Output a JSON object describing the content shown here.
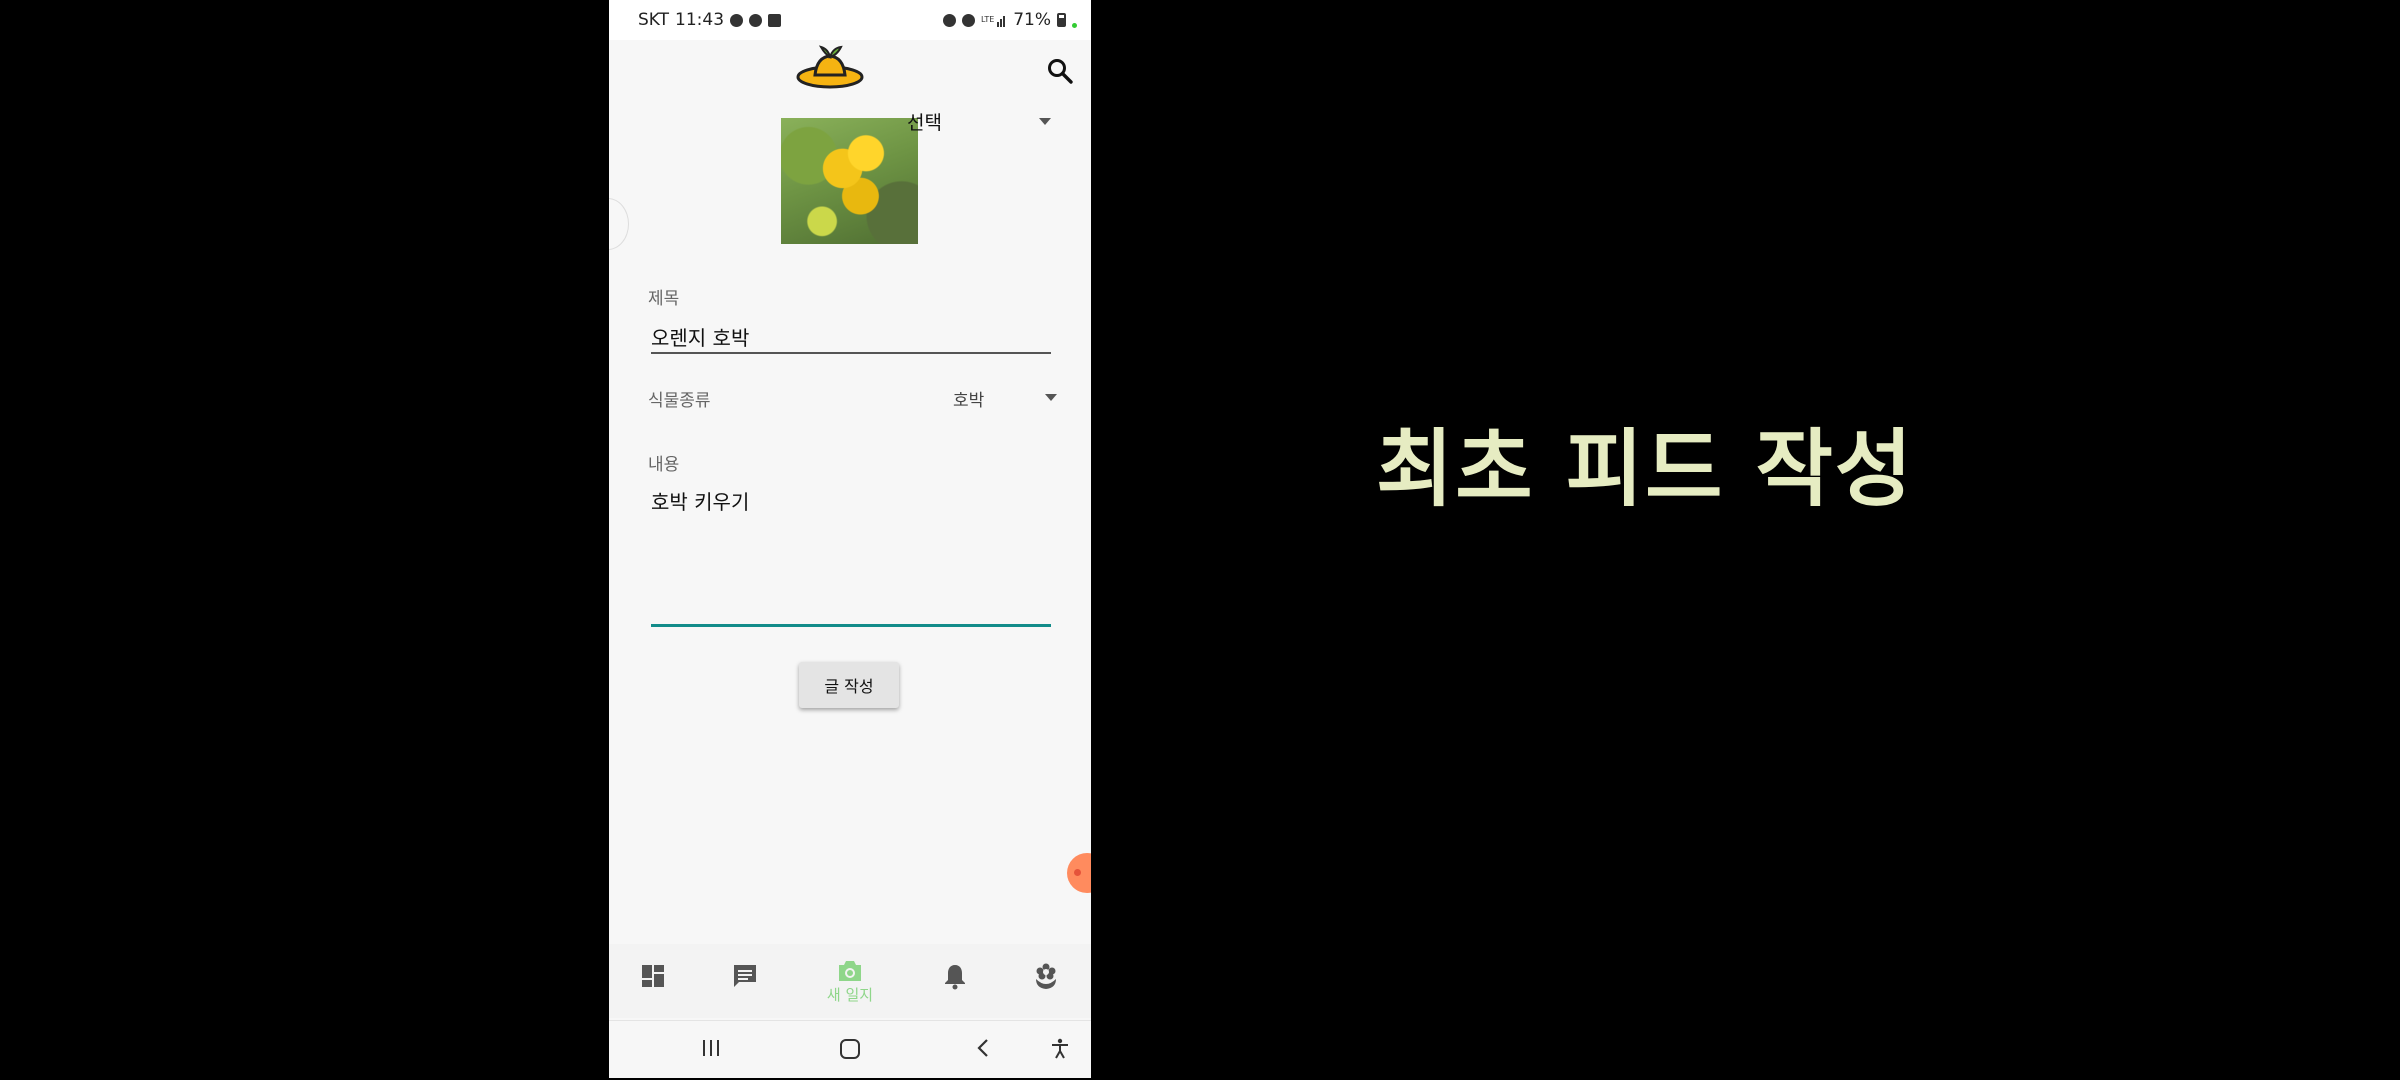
{
  "status_bar": {
    "carrier": "SKT",
    "time": "11:43",
    "battery": "71%"
  },
  "header": {
    "logo_icon": "orange-logo-icon",
    "search_icon": "search-icon"
  },
  "form": {
    "photo_select": {
      "selected": "선택"
    },
    "title_label": "제목",
    "title_value": "오렌지 호박",
    "plant_type_label": "식물종류",
    "plant_type_value": "호박",
    "content_label": "내용",
    "content_value": "호박 키우기",
    "submit_label": "글 작성",
    "accent_color": "#128c8a"
  },
  "bottom_nav": {
    "items": [
      {
        "icon": "dashboard-icon"
      },
      {
        "icon": "chat-icon"
      },
      {
        "icon": "camera-icon",
        "label": "새 일지",
        "active": true
      },
      {
        "icon": "bell-icon"
      },
      {
        "icon": "plant-icon"
      }
    ],
    "active_color": "#8fd68a"
  },
  "system_nav": {
    "buttons": [
      "recent-apps-icon",
      "home-icon",
      "back-icon",
      "accessibility-icon"
    ]
  },
  "overlay": {
    "caption": "최초 피드 작성"
  }
}
